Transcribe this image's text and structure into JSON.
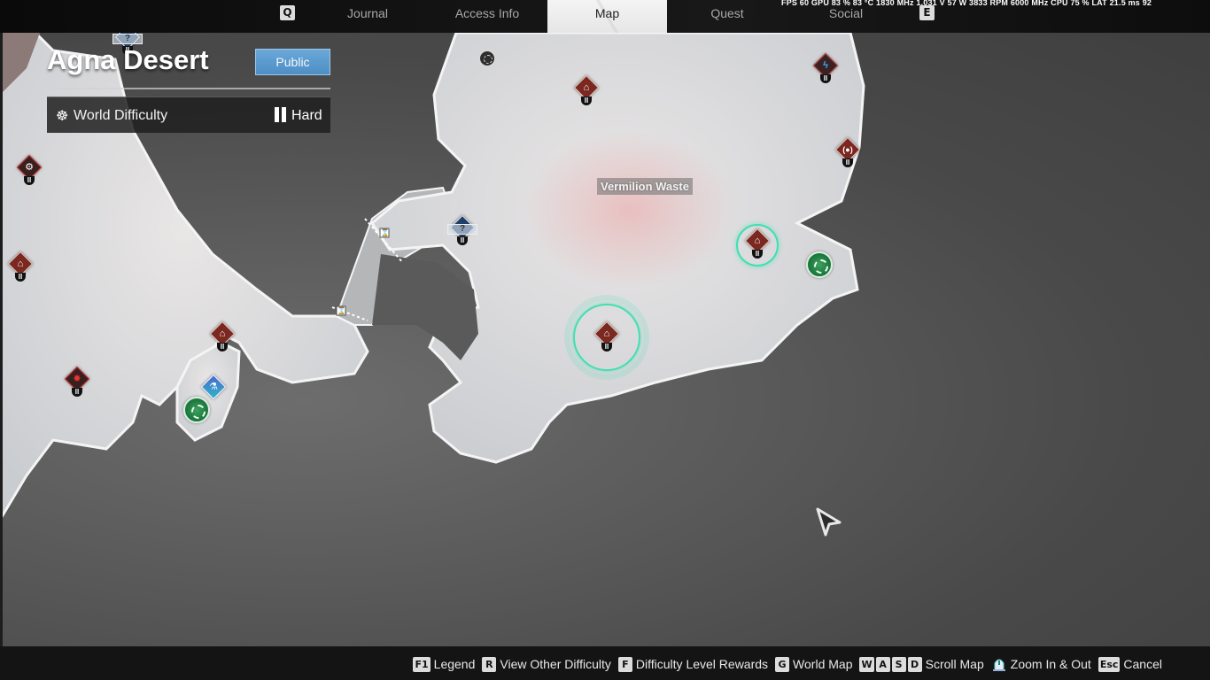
{
  "topbar": {
    "left_key": "Q",
    "right_key": "E",
    "tabs": [
      {
        "label": "Journal",
        "active": false
      },
      {
        "label": "Access Info",
        "active": false
      },
      {
        "label": "Map",
        "active": true
      },
      {
        "label": "Quest",
        "active": false
      },
      {
        "label": "Social",
        "active": false
      }
    ],
    "perf_overlay": "FPS  60   GPU 83 %  83 °C  1830 MHz  1.031 V  57 W  3833 RPM  6000 MHz  CPU  75 %  LAT  21.5 ms  92"
  },
  "header": {
    "zone_name": "Agna Desert",
    "session_button": "Public",
    "difficulty_label": "World Difficulty",
    "difficulty_value": "Hard"
  },
  "map": {
    "region_label": "Vermilion Waste",
    "markers": [
      {
        "type": "dungeon",
        "tier": "II",
        "glyph": "⌂"
      },
      {
        "type": "dungeon",
        "tier": "II",
        "glyph": "⌂"
      },
      {
        "type": "dungeon",
        "tier": "II",
        "glyph": "⌂"
      },
      {
        "type": "dungeon",
        "tier": "II",
        "glyph": "⌂"
      },
      {
        "type": "dungeon",
        "tier": "II",
        "glyph": "⌂"
      },
      {
        "type": "boss",
        "tier": "II",
        "glyph": "✸"
      },
      {
        "type": "outpost",
        "tier": "II",
        "glyph": "⚙"
      },
      {
        "type": "lightning-boss",
        "tier": "II",
        "glyph": "ϟ"
      },
      {
        "type": "signal",
        "tier": "II",
        "glyph": "(●)"
      },
      {
        "type": "unknown",
        "tier": "II",
        "glyph": "?"
      },
      {
        "type": "unknown",
        "tier": "II",
        "glyph": "?"
      },
      {
        "type": "research",
        "tier": "",
        "glyph": "⚗"
      }
    ],
    "colors": {
      "accent_ring": "#3fe0b0",
      "dungeon": "#7a2820",
      "public_button": "#5a9acc"
    }
  },
  "bottombar": {
    "hints": [
      {
        "keys": [
          "F1"
        ],
        "label": "Legend"
      },
      {
        "keys": [
          "R"
        ],
        "label": "View Other Difficulty"
      },
      {
        "keys": [
          "F"
        ],
        "label": "Difficulty Level Rewards"
      },
      {
        "keys": [
          "G"
        ],
        "label": "World Map"
      },
      {
        "keys": [
          "W",
          "A",
          "S",
          "D"
        ],
        "label": "Scroll Map"
      },
      {
        "keys": [],
        "icon": "mouse-wheel-icon",
        "label": "Zoom In & Out"
      },
      {
        "keys": [
          "Esc"
        ],
        "label": "Cancel"
      }
    ]
  }
}
